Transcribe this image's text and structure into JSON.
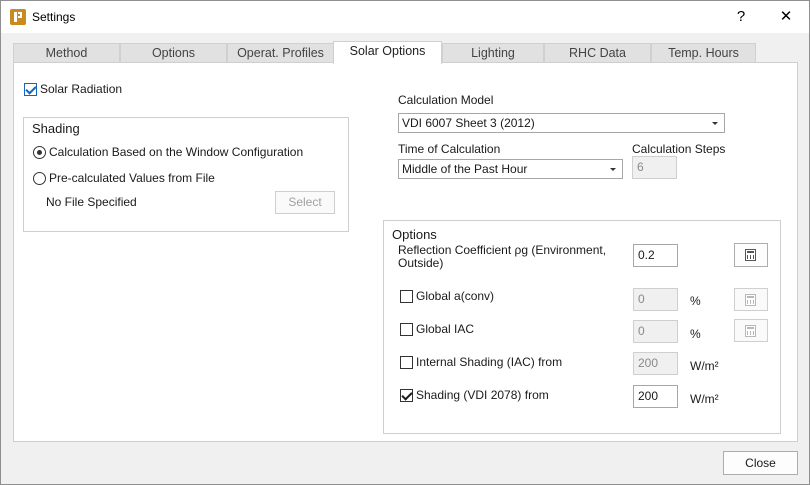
{
  "window": {
    "title": "Settings",
    "help_label": "?",
    "close_glyph": "✕"
  },
  "tabs": [
    {
      "label": "Method",
      "active": false
    },
    {
      "label": "Options",
      "active": false
    },
    {
      "label": "Operat. Profiles",
      "active": false
    },
    {
      "label": "Solar Options",
      "active": true
    },
    {
      "label": "Lighting",
      "active": false
    },
    {
      "label": "RHC Data",
      "active": false
    },
    {
      "label": "Temp. Hours",
      "active": false
    }
  ],
  "solar_radiation": {
    "label": "Solar Radiation",
    "checked": true
  },
  "shading": {
    "title": "Shading",
    "option_window": {
      "label": "Calculation Based on the Window Configuration",
      "selected": true
    },
    "option_file": {
      "label": "Pre-calculated Values from File",
      "selected": false
    },
    "file_status": "No File Specified",
    "select_button": "Select"
  },
  "calc_model": {
    "label": "Calculation Model",
    "value": "VDI 6007 Sheet 3 (2012)"
  },
  "time_calc": {
    "label": "Time of Calculation",
    "value": "Middle of the Past Hour"
  },
  "calc_steps": {
    "label": "Calculation Steps",
    "value": "6"
  },
  "options": {
    "title": "Options",
    "reflection": {
      "label": "Reflection Coefficient ρg (Environment, Outside)",
      "value": "0.2"
    },
    "global_aconv": {
      "label": "Global a(conv)",
      "checked": false,
      "value": "0",
      "unit": "%"
    },
    "global_iac": {
      "label": "Global IAC",
      "checked": false,
      "value": "0",
      "unit": "%"
    },
    "internal_shading": {
      "label": "Internal Shading (IAC) from",
      "checked": false,
      "value": "200",
      "unit": "W/m²"
    },
    "shading_vdi": {
      "label": "Shading (VDI 2078) from",
      "checked": true,
      "value": "200",
      "unit": "W/m²"
    }
  },
  "footer": {
    "close_button": "Close"
  },
  "icons": {
    "calculator": "calculator-icon",
    "app": "app-logo-icon"
  }
}
